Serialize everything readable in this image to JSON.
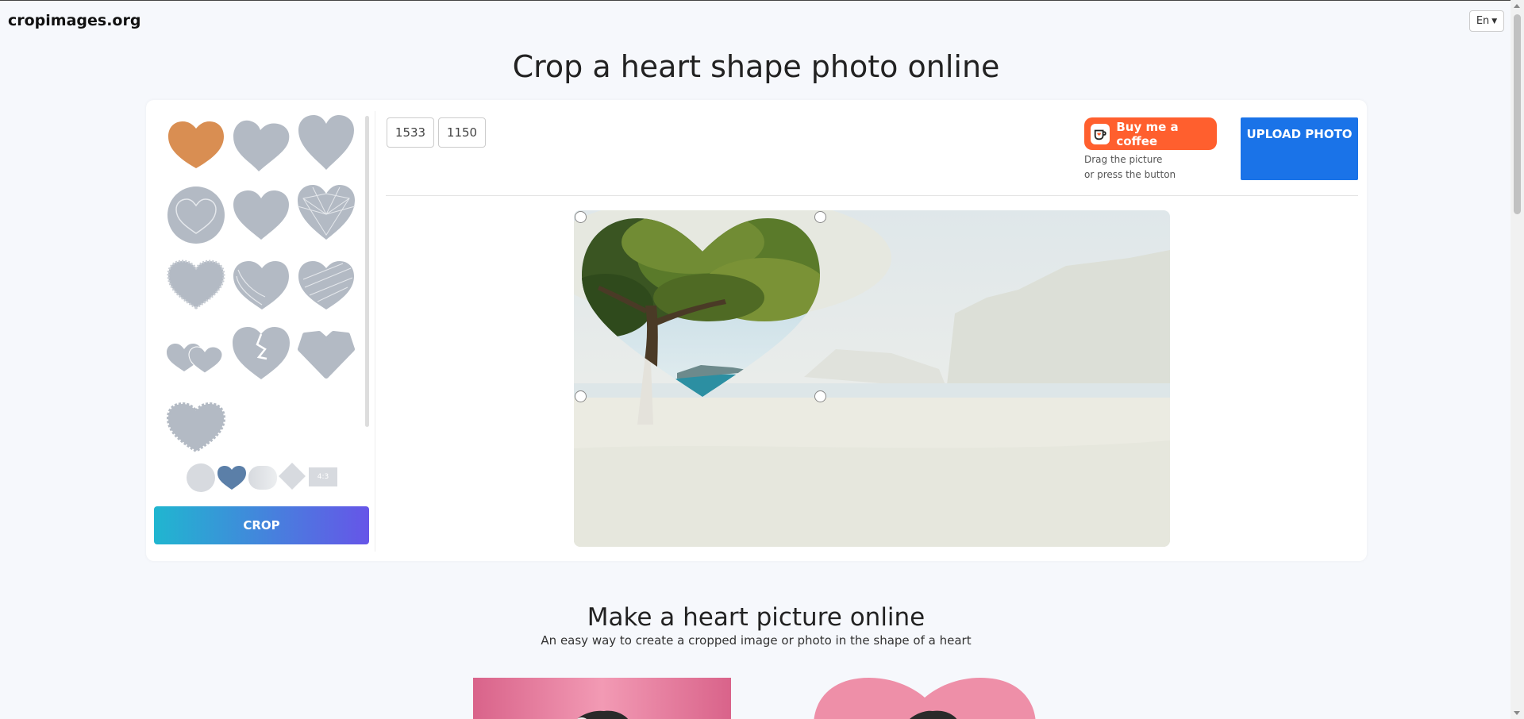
{
  "site": {
    "brand": "cropimages.org",
    "language": "En"
  },
  "page": {
    "title": "Crop a heart shape photo online"
  },
  "editor": {
    "width_value": "1533",
    "height_value": "1150",
    "coffee_label": "Buy me a coffee",
    "hint_line1": "Drag the picture",
    "hint_line2": "or press the button",
    "upload_label": "UPLOAD PHOTO",
    "crop_label": "CROP",
    "ratio_label": "4:3",
    "selected_color": "#d98e52",
    "shape_color": "#b3bac4",
    "shapes": [
      {
        "name": "heart-classic",
        "selected": true
      },
      {
        "name": "heart-tilted"
      },
      {
        "name": "heart-tall"
      },
      {
        "name": "heart-circle"
      },
      {
        "name": "heart-wide"
      },
      {
        "name": "heart-diamond"
      },
      {
        "name": "heart-rough"
      },
      {
        "name": "heart-swirl"
      },
      {
        "name": "heart-scribble"
      },
      {
        "name": "heart-double"
      },
      {
        "name": "heart-broken"
      },
      {
        "name": "heart-sharp"
      },
      {
        "name": "heart-scalloped"
      }
    ]
  },
  "section": {
    "title": "Make a heart picture online",
    "subtitle": "An easy way to create a cropped image or photo in the shape of a heart"
  }
}
